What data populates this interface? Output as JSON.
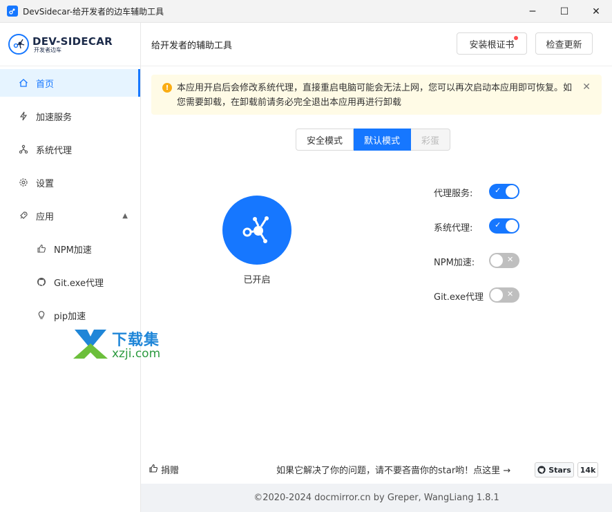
{
  "window": {
    "title": "DevSidecar-给开发者的边车辅助工具",
    "controls": {
      "minimize": "─",
      "maximize": "☐",
      "close": "✕"
    }
  },
  "brand": {
    "name": "DEV-SIDECAR",
    "subtitle": "开发者边车"
  },
  "sidebar": {
    "items": [
      {
        "label": "首页",
        "icon": "home-icon"
      },
      {
        "label": "加速服务",
        "icon": "lightning-icon"
      },
      {
        "label": "系统代理",
        "icon": "network-icon"
      },
      {
        "label": "设置",
        "icon": "gear-icon"
      },
      {
        "label": "应用",
        "icon": "rocket-icon"
      },
      {
        "label": "NPM加速",
        "icon": "thumb-up-icon"
      },
      {
        "label": "Git.exe代理",
        "icon": "github-icon"
      },
      {
        "label": "pip加速",
        "icon": "bulb-icon"
      }
    ]
  },
  "watermark": {
    "cn": "下载集",
    "en": "xzji.com"
  },
  "header": {
    "title": "给开发者的辅助工具",
    "install_cert": "安装根证书",
    "check_update": "检查更新"
  },
  "alert": {
    "text": "本应用开启后会修改系统代理，直接重启电脑可能会无法上网，您可以再次启动本应用即可恢复。如您需要卸载，在卸载前请务必完全退出本应用再进行卸载"
  },
  "modes": [
    "安全模式",
    "默认模式",
    "彩蛋"
  ],
  "power": {
    "status": "已开启"
  },
  "switches": [
    {
      "label": "代理服务:",
      "on": true
    },
    {
      "label": "系统代理:",
      "on": true
    },
    {
      "label": "NPM加速:",
      "on": false
    },
    {
      "label": "Git.exe代理",
      "on": false
    }
  ],
  "bottom": {
    "donate": "捐赠",
    "star_prompt": "如果它解决了你的问题，请不要吝啬你的star哟！点这里 →",
    "stars_label": "Stars",
    "stars_count": "14k"
  },
  "footer": {
    "text": "©2020-2024 docmirror.cn by Greper, WangLiang 1.8.1"
  },
  "colors": {
    "primary": "#1677ff",
    "warning": "#faad14",
    "alert_bg": "#fffbe6"
  }
}
